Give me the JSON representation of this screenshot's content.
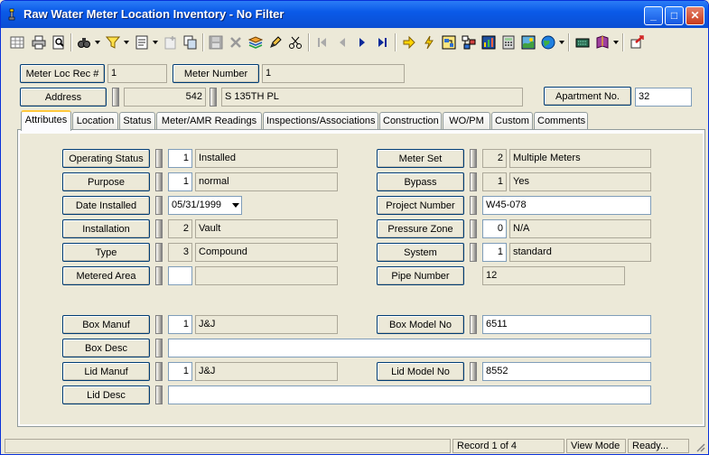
{
  "window": {
    "title": "Raw Water Meter Location Inventory - No Filter",
    "minimize": "_",
    "maximize": "□",
    "close": "✕"
  },
  "header": {
    "meter_loc_rec_label": "Meter Loc Rec #",
    "meter_loc_rec_value": "1",
    "meter_number_label": "Meter Number",
    "meter_number_value": "1",
    "address_label": "Address",
    "address_number": "542",
    "address_street": "S 135TH PL",
    "apartment_label": "Apartment No.",
    "apartment_value": "32"
  },
  "tabs": [
    "Attributes",
    "Location",
    "Status",
    "Meter/AMR Readings",
    "Inspections/Associations",
    "Construction",
    "WO/PM",
    "Custom",
    "Comments"
  ],
  "attributes": {
    "operating_status": {
      "label": "Operating Status",
      "code": "1",
      "desc": "Installed"
    },
    "purpose": {
      "label": "Purpose",
      "code": "1",
      "desc": "normal"
    },
    "date_installed": {
      "label": "Date Installed",
      "value": "05/31/1999"
    },
    "installation": {
      "label": "Installation",
      "code": "2",
      "desc": "Vault"
    },
    "type": {
      "label": "Type",
      "code": "3",
      "desc": "Compound"
    },
    "metered_area": {
      "label": "Metered Area",
      "code": "",
      "desc": ""
    },
    "meter_set": {
      "label": "Meter Set",
      "code": "2",
      "desc": "Multiple Meters"
    },
    "bypass": {
      "label": "Bypass",
      "code": "1",
      "desc": "Yes"
    },
    "project_number": {
      "label": "Project Number",
      "value": "W45-078"
    },
    "pressure_zone": {
      "label": "Pressure Zone",
      "code": "0",
      "desc": "N/A"
    },
    "system": {
      "label": "System",
      "code": "1",
      "desc": "standard"
    },
    "pipe_number": {
      "label": "Pipe Number",
      "value": "12"
    },
    "box_manuf": {
      "label": "Box Manuf",
      "code": "1",
      "desc": "J&J"
    },
    "box_model_no": {
      "label": "Box Model No",
      "value": "6511"
    },
    "box_desc": {
      "label": "Box Desc",
      "value": ""
    },
    "lid_manuf": {
      "label": "Lid Manuf",
      "code": "1",
      "desc": "J&J"
    },
    "lid_model_no": {
      "label": "Lid Model No",
      "value": "8552"
    },
    "lid_desc": {
      "label": "Lid Desc",
      "value": ""
    }
  },
  "statusbar": {
    "record": "Record 1 of 4",
    "mode": "View Mode",
    "state": "Ready..."
  },
  "colors": {
    "titlebar": "#0a5ae8",
    "face": "#ece9d8",
    "field_border": "#7f9db9"
  }
}
